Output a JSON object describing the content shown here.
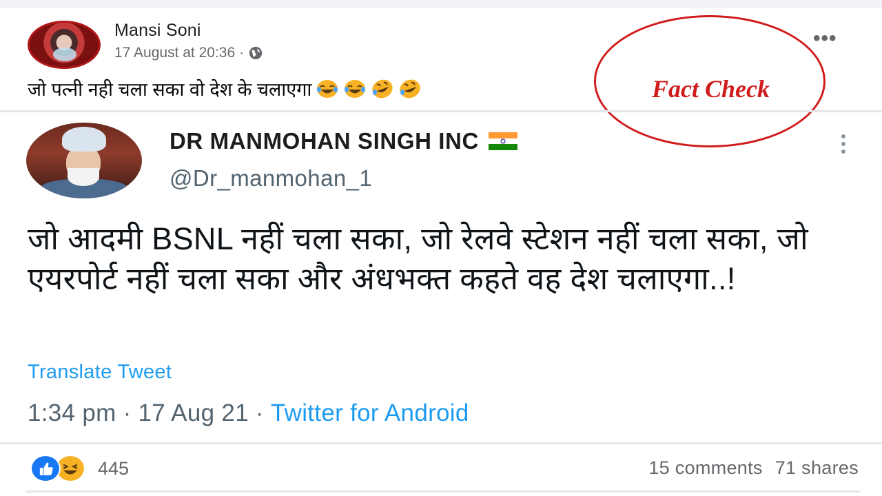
{
  "post": {
    "author": "Mansi Soni",
    "timestamp": "17 August at 20:36",
    "separator": "·",
    "privacy_icon": "globe-icon",
    "caption": "जो पत्नी नही चला सका वो देश के चलाएगा",
    "caption_emojis": [
      "joy-emoji",
      "joy-emoji",
      "rofl-emoji",
      "rofl-emoji"
    ],
    "more_label": "•••"
  },
  "overlay": {
    "label": "Fact Check",
    "color": "#d01c1c"
  },
  "tweet": {
    "name": "DR MANMOHAN SINGH INC",
    "name_icon": "india-flag-icon",
    "handle": "@Dr_manmohan_1",
    "text": "जो आदमी BSNL नहीं चला सका, जो रेलवे स्टेशन नहीं चला सका, जो एयरपोर्ट नहीं चला सका और अंधभक्त कहते वह देश चलाएगा..!",
    "translate_label": "Translate Tweet",
    "time": "1:34 pm",
    "date": "17 Aug 21",
    "sep": "·",
    "source": "Twitter for Android",
    "link_color": "#1d9bf0"
  },
  "footer": {
    "reaction_icons": [
      "like-icon",
      "haha-icon"
    ],
    "reaction_count": "445",
    "comments": "15 comments",
    "shares": "71 shares"
  }
}
